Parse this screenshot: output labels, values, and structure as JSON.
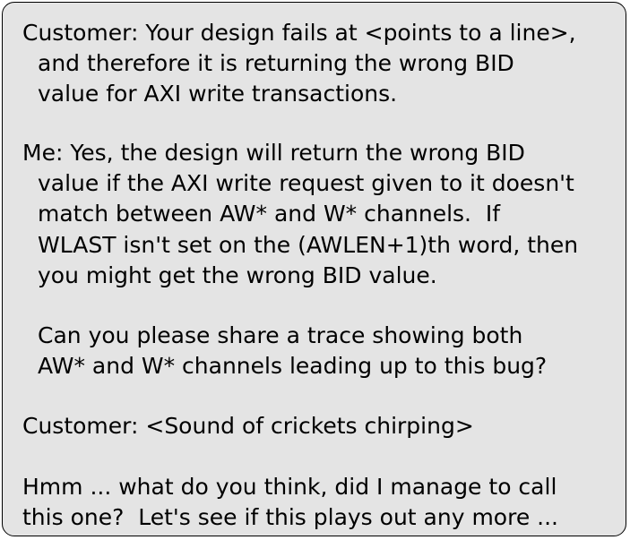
{
  "conversation": {
    "customer_complaint": {
      "line1": "Customer: Your design fails at <points to a line>,",
      "line2": "and therefore it is returning the wrong BID",
      "line3": "value for AXI write transactions."
    },
    "my_reply": {
      "line1": "Me: Yes, the design will return the wrong BID",
      "line2": "value if the AXI write request given to it doesn't",
      "line3": "match between AW* and W* channels.  If",
      "line4": "WLAST isn't set on the (AWLEN+1)th word, then",
      "line5": "you might get the wrong BID value.",
      "request_line1": "Can you please share a trace showing both",
      "request_line2": "AW* and W* channels leading up to this bug?"
    },
    "customer_response": {
      "line1": "Customer: <Sound of crickets chirping>"
    },
    "closing": {
      "line1": "Hmm ... what do you think, did I manage to call",
      "line2": "this one?  Let's see if this plays out any more ..."
    }
  },
  "colors": {
    "background": "#e4e4e4",
    "border": "#000000",
    "text": "#000000"
  }
}
